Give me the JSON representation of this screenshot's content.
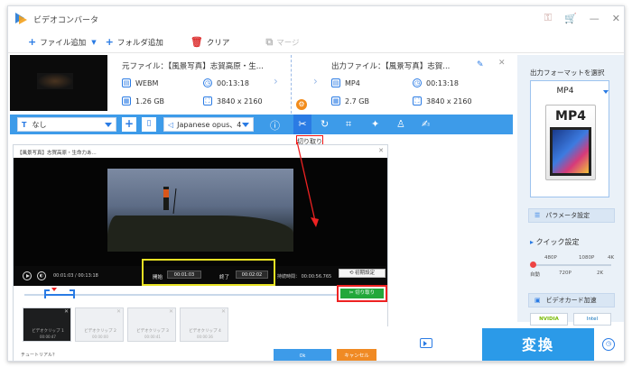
{
  "app": {
    "title": "ビデオコンバータ"
  },
  "toolbar": {
    "add_file": "ファイル追加",
    "add_folder": "フォルダ追加",
    "clear": "クリア",
    "merge": "マージ"
  },
  "file": {
    "source_label": "元ファイル：【風景写真】志賀高原・生...",
    "output_label": "出力ファイル：【風景写真】志賀...",
    "src_format": "WEBM",
    "src_duration": "00:13:18",
    "src_size": "1.26 GB",
    "src_resolution": "3840 x 2160",
    "out_format": "MP4",
    "out_duration": "00:13:18",
    "out_size": "2.7 GB",
    "out_resolution": "3840 x 2160"
  },
  "editbar": {
    "subtitle": "なし",
    "audio": "Japanese opus、4",
    "tooltip": "切り取り"
  },
  "dialog": {
    "title": "【風景写真】志賀高原・生命力あ...",
    "time_current": "00:01:03",
    "time_total": "00:13:18",
    "start_label": "開始",
    "start_value": "00:01:03",
    "end_label": "終了",
    "end_value": "00:02:02",
    "clip_duration": "持続時間：  00:00:56.765",
    "reset": "初期設定",
    "cut_button": "切り取り",
    "clips": [
      {
        "label": "ビデオクリップ 1",
        "time": "00:00:47"
      },
      {
        "label": "ビデオクリップ 2",
        "time": "00:00:00"
      },
      {
        "label": "ビデオクリップ 3",
        "time": "00:00:41"
      },
      {
        "label": "ビデオクリップ 4",
        "time": "00:00:36"
      }
    ],
    "tutorial": "チュートリアル？",
    "ok": "Ok",
    "cancel": "キャンセル"
  },
  "right_panel": {
    "title": "出力フォーマットを選択",
    "format": "MP4",
    "format_icon_text": "MP4",
    "param_settings": "パラメータ設定",
    "quick_settings": "クイック設定",
    "quality_top": [
      "480P",
      "1080P",
      "4K"
    ],
    "quality_bottom": [
      "自動",
      "720P",
      "2K"
    ],
    "gpu": "ビデオカード加速",
    "nvidia": "NVIDIA",
    "intel": "Intel"
  },
  "bottom": {
    "convert": "変換"
  },
  "colors": {
    "accent": "#3d9be9",
    "convert": "#2b9ae8",
    "highlight_yellow": "#e7e123",
    "highlight_red": "#e22",
    "cut_green": "#22a83a"
  }
}
